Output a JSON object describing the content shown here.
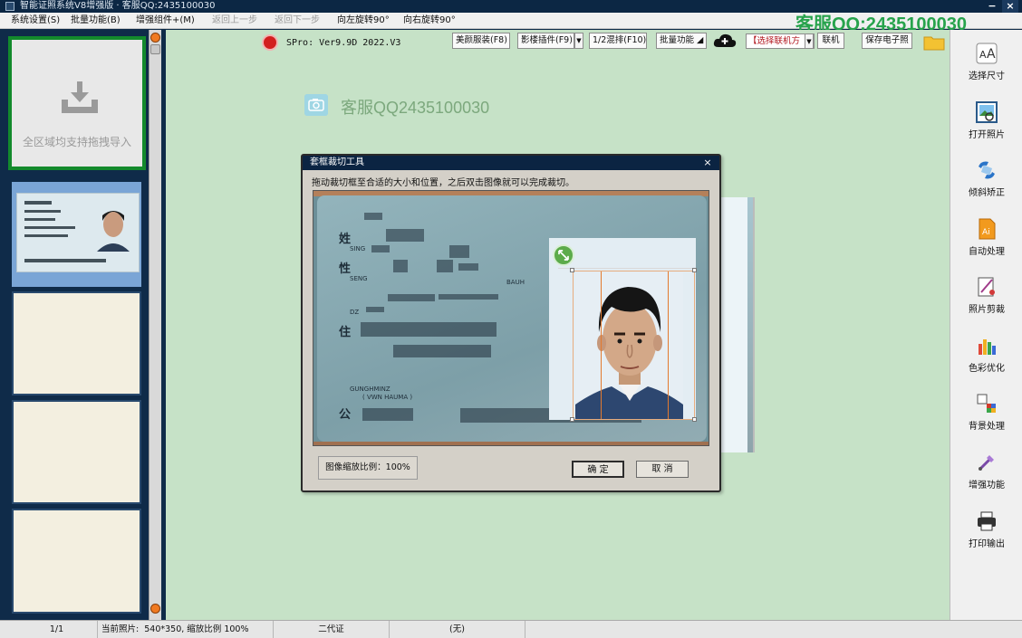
{
  "window": {
    "title": "智能证照系统V8增强版 · 客服QQ:2435100030",
    "watermark_top": "客服QQ:2435100030"
  },
  "menu": {
    "items": [
      {
        "label": "系统设置(S)",
        "enabled": true
      },
      {
        "label": "批量功能(B)",
        "enabled": true
      },
      {
        "label": "增强组件+(M)",
        "enabled": true
      },
      {
        "label": "返回上一步",
        "enabled": false
      },
      {
        "label": "返回下一步",
        "enabled": false
      },
      {
        "label": "向左旋转90°",
        "enabled": true
      },
      {
        "label": "向右旋转90°",
        "enabled": true
      }
    ]
  },
  "left_panel": {
    "import_text": "全区域均支持拖拽导入"
  },
  "toolbar": {
    "version": "SPro: Ver9.9D 2022.V3",
    "beauty_button": "美颜服装(F8)",
    "shadow_button": "影楼插件(F9)",
    "mix_button": "1/2混排(F10)",
    "batch_button": "批量功能",
    "connector_select": "【选择联机方",
    "connect_button": "联机",
    "save_button": "保存电子照"
  },
  "workspace": {
    "watermark": "客服QQ2435100030"
  },
  "dialog": {
    "title": "套框裁切工具",
    "hint": "拖动裁切框至合适的大小和位置，之后双击图像就可以完成裁切。",
    "zoom_text": "图像缩放比例：100%",
    "confirm_button": "确 定",
    "cancel_button": "取 消",
    "card_labels": {
      "name": "姓",
      "gender": "性",
      "address": "住",
      "name_en": "SING",
      "gender_en": "SENG",
      "dz": "DZ",
      "gender_suffix": "BAUH",
      "gh": "GUNGHMINZ",
      "gh2": "( VWN HAUMA )",
      "gong": "公"
    }
  },
  "right_panel": {
    "tools": [
      {
        "label": "选择尺寸",
        "icon": "font-size-icon",
        "color": "#555555"
      },
      {
        "label": "打开照片",
        "icon": "open-photo-icon",
        "color": "#3a8ad6"
      },
      {
        "label": "倾斜矫正",
        "icon": "tilt-correct-icon",
        "color": "#2a74c8"
      },
      {
        "label": "自动处理",
        "icon": "auto-process-icon",
        "color": "#e08a15"
      },
      {
        "label": "照片剪裁",
        "icon": "photo-crop-icon",
        "color": "#a03b8a"
      },
      {
        "label": "色彩优化",
        "icon": "color-optimize-icon",
        "color": "#3aa64a"
      },
      {
        "label": "背景处理",
        "icon": "background-icon",
        "color": "#c23a2a"
      },
      {
        "label": "增强功能",
        "icon": "enhance-icon",
        "color": "#7a4aa8"
      },
      {
        "label": "打印输出",
        "icon": "print-icon",
        "color": "#333333"
      }
    ]
  },
  "statusbar": {
    "page": "1/1",
    "current_label": "当前照片:",
    "current_value": "540*350, 缩放比例 100%",
    "doc_type": "二代证",
    "extra": "(无)"
  }
}
